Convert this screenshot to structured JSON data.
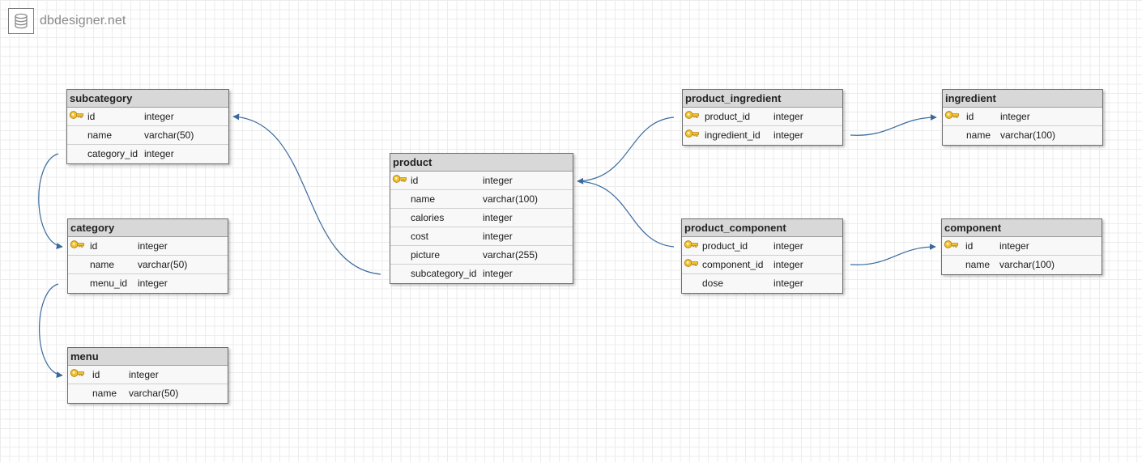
{
  "brand": {
    "name": "dbdesigner.net",
    "icon": "database-icon"
  },
  "colors": {
    "connector": "#3a6a9c",
    "key": "#e6b21a",
    "header": "#d8d8d8"
  },
  "tables": {
    "subcategory": {
      "title": "subcategory",
      "rows": [
        {
          "name": "id",
          "type": "integer",
          "key": true
        },
        {
          "name": "name",
          "type": "varchar(50)",
          "key": false
        },
        {
          "name": "category_id",
          "type": "integer",
          "key": false
        }
      ]
    },
    "category": {
      "title": "category",
      "rows": [
        {
          "name": "id",
          "type": "integer",
          "key": true
        },
        {
          "name": "name",
          "type": "varchar(50)",
          "key": false
        },
        {
          "name": "menu_id",
          "type": "integer",
          "key": false
        }
      ]
    },
    "menu": {
      "title": "menu",
      "rows": [
        {
          "name": "id",
          "type": "integer",
          "key": true
        },
        {
          "name": "name",
          "type": "varchar(50)",
          "key": false
        }
      ]
    },
    "product": {
      "title": "product",
      "rows": [
        {
          "name": "id",
          "type": "integer",
          "key": true
        },
        {
          "name": "name",
          "type": "varchar(100)",
          "key": false
        },
        {
          "name": "calories",
          "type": "integer",
          "key": false
        },
        {
          "name": "cost",
          "type": "integer",
          "key": false
        },
        {
          "name": "picture",
          "type": "varchar(255)",
          "key": false
        },
        {
          "name": "subcategory_id",
          "type": "integer",
          "key": false
        }
      ]
    },
    "product_ingredient": {
      "title": "product_ingredient",
      "rows": [
        {
          "name": "product_id",
          "type": "integer",
          "key": true
        },
        {
          "name": "ingredient_id",
          "type": "integer",
          "key": true
        }
      ]
    },
    "product_component": {
      "title": "product_component",
      "rows": [
        {
          "name": "product_id",
          "type": "integer",
          "key": true
        },
        {
          "name": "component_id",
          "type": "integer",
          "key": true
        },
        {
          "name": "dose",
          "type": "integer",
          "key": false
        }
      ]
    },
    "ingredient": {
      "title": "ingredient",
      "rows": [
        {
          "name": "id",
          "type": "integer",
          "key": true
        },
        {
          "name": "name",
          "type": "varchar(100)",
          "key": false
        }
      ]
    },
    "component": {
      "title": "component",
      "rows": [
        {
          "name": "id",
          "type": "integer",
          "key": true
        },
        {
          "name": "name",
          "type": "varchar(100)",
          "key": false
        }
      ]
    }
  },
  "relations": [
    {
      "from": "subcategory.category_id",
      "to": "category.id"
    },
    {
      "from": "category.menu_id",
      "to": "menu.id"
    },
    {
      "from": "product.subcategory_id",
      "to": "subcategory.id"
    },
    {
      "from": "product_ingredient.product_id",
      "to": "product.id"
    },
    {
      "from": "product_component.product_id",
      "to": "product.id"
    },
    {
      "from": "product_ingredient.ingredient_id",
      "to": "ingredient.id"
    },
    {
      "from": "product_component.component_id",
      "to": "component.id"
    }
  ]
}
